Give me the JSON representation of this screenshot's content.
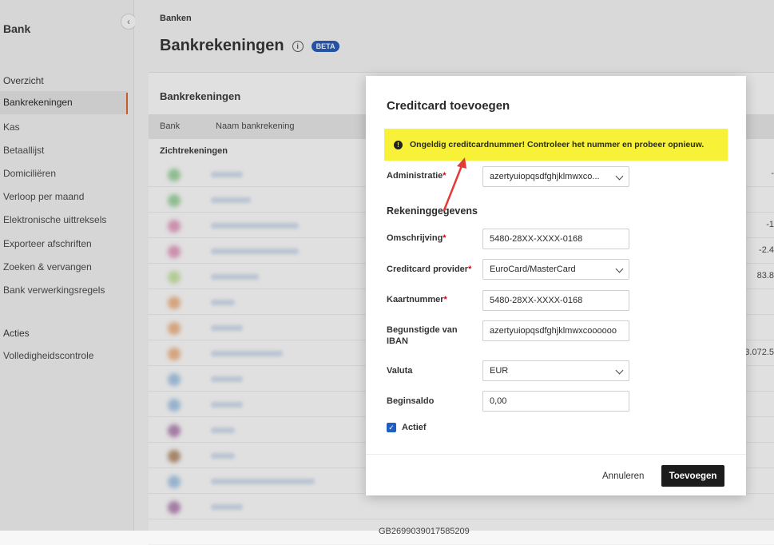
{
  "sidebar": {
    "title": "Bank",
    "collapse_icon": "chevron-left-icon",
    "section_overview": "Overzicht",
    "items": [
      {
        "label": "Bankrekeningen",
        "active": true
      },
      {
        "label": "Kas"
      },
      {
        "label": "Betaallijst"
      },
      {
        "label": "Domiciliëren"
      },
      {
        "label": "Verloop per maand"
      },
      {
        "label": "Elektronische uittreksels"
      },
      {
        "label": "Exporteer afschriften"
      },
      {
        "label": "Zoeken & vervangen"
      },
      {
        "label": "Bank verwerkingsregels"
      }
    ],
    "section_actions": "Acties",
    "action_items": [
      {
        "label": "Volledigheidscontrole"
      }
    ]
  },
  "header": {
    "breadcrumb": "Banken",
    "title": "Bankrekeningen",
    "info_icon": "i",
    "badge": "BETA"
  },
  "panel": {
    "title": "Bankrekeningen",
    "columns": [
      "Bank",
      "Naam bankrekening"
    ],
    "group_label": "Zichtrekeningen",
    "right_values": [
      "-",
      "",
      "-1",
      "-2.4",
      "83.8",
      "",
      "",
      "3.072.5",
      "",
      "",
      "",
      "",
      "",
      "",
      ""
    ],
    "visible_iban": "GB2699039017585209"
  },
  "modal": {
    "title": "Creditcard toevoegen",
    "alert": {
      "icon": "exclamation-icon",
      "text": "Ongeldig creditcardnummer! Controleer het nummer en probeer opnieuw."
    },
    "administratie": {
      "label": "Administratie",
      "required": "*",
      "value": "azertyuiopqsdfghjklmwxco..."
    },
    "section": "Rekeninggegevens",
    "omschrijving": {
      "label": "Omschrijving",
      "required": "*",
      "value": "5480-28XX-XXXX-0168"
    },
    "provider": {
      "label": "Creditcard provider",
      "required": "*",
      "value": "EuroCard/MasterCard"
    },
    "kaartnummer": {
      "label": "Kaartnummer",
      "required": "*",
      "value": "5480-28XX-XXXX-0168"
    },
    "begunstigde": {
      "label": "Begunstigde van IBAN",
      "value": "azertyuiopqsdfghjklmwxcoooooo"
    },
    "valuta": {
      "label": "Valuta",
      "value": "EUR"
    },
    "beginsaldo": {
      "label": "Beginsaldo",
      "value": "0,00"
    },
    "actief": {
      "label": "Actief",
      "checked": true
    },
    "cancel_label": "Annuleren",
    "submit_label": "Toevoegen"
  },
  "colors": {
    "accent": "#e0622a",
    "brand_blue": "#1f57b8",
    "alert_yellow": "#f7f237",
    "arrow_red": "#e53935"
  }
}
